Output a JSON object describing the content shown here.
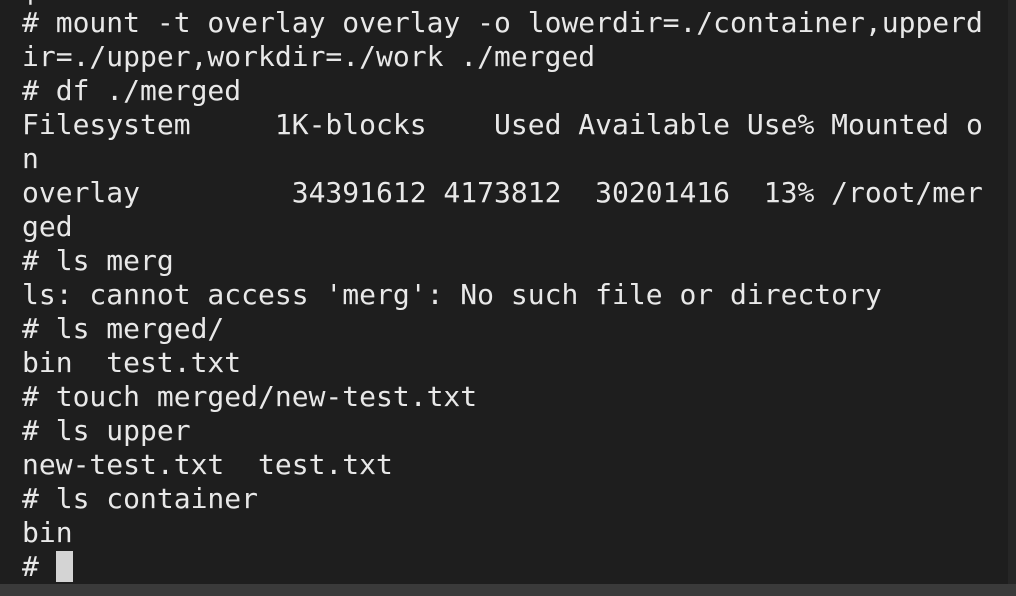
{
  "terminal": {
    "partial_top_line": "|",
    "lines": [
      "# mount -t overlay overlay -o lowerdir=./container,upperd",
      "ir=./upper,workdir=./work ./merged",
      "# df ./merged",
      "Filesystem     1K-blocks    Used Available Use% Mounted o",
      "n",
      "overlay         34391612 4173812  30201416  13% /root/mer",
      "ged",
      "# ls merg",
      "ls: cannot access 'merg': No such file or directory",
      "# ls merged/",
      "bin  test.txt",
      "# touch merged/new-test.txt",
      "# ls upper",
      "new-test.txt  test.txt",
      "# ls container",
      "bin"
    ],
    "prompt": "# ",
    "colors": {
      "background": "#1e1e1e",
      "foreground": "#e8e8e8",
      "cursor": "#d4d4d4",
      "bottom_strip": "#3a3a3a"
    }
  }
}
